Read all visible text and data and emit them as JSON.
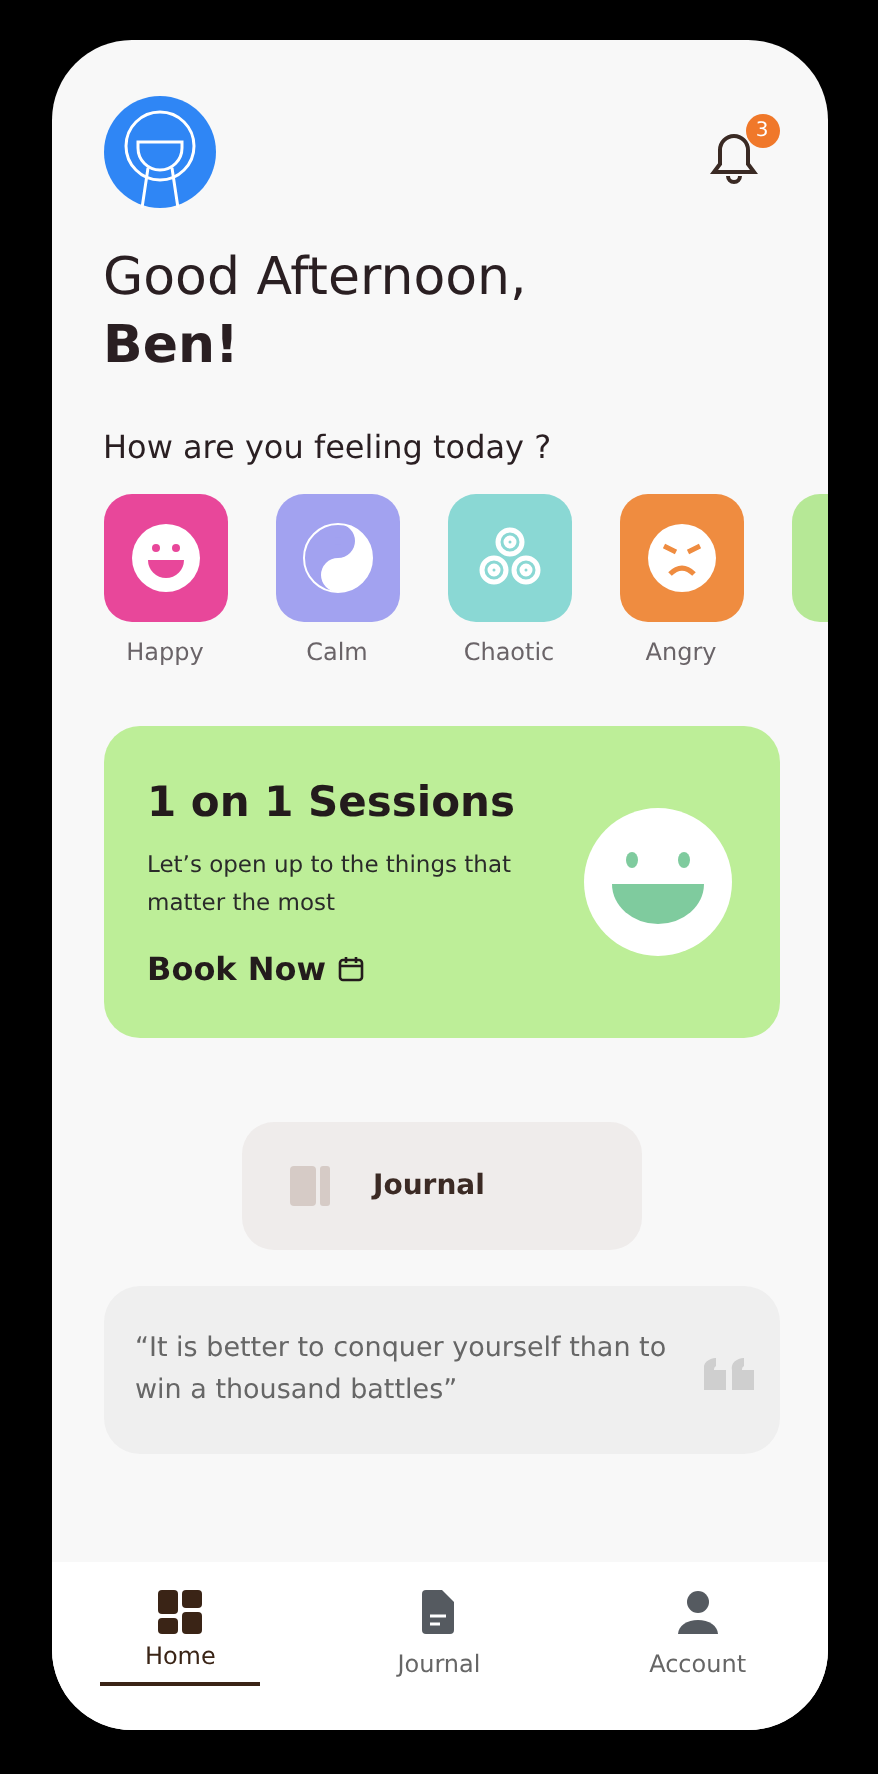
{
  "header": {
    "notification_count": "3"
  },
  "greeting": {
    "line_1": "Good Afternoon,",
    "line_2": "Ben!"
  },
  "mood_prompt": "How are you feeling today ?",
  "moods": [
    {
      "kind": "happy",
      "label": "Happy",
      "color": "#e8479a"
    },
    {
      "kind": "calm",
      "label": "Calm",
      "color": "#a2a2f0"
    },
    {
      "kind": "chaotic",
      "label": "Chaotic",
      "color": "#8ad8d4"
    },
    {
      "kind": "angry",
      "label": "Angry",
      "color": "#ef8c40"
    },
    {
      "kind": "partial",
      "color": "#b6e896"
    }
  ],
  "session_card": {
    "title": "1 on 1 Sessions",
    "text": "Let’s open up to the things that matter the most",
    "action": "Book Now"
  },
  "journal_button": "Journal",
  "quote": "“It is better to conquer yourself than to win a thousand battles”",
  "nav": [
    {
      "kind": "home",
      "label": "Home",
      "selected": true
    },
    {
      "kind": "journal",
      "label": "Journal",
      "selected": false
    },
    {
      "kind": "account",
      "label": "Account",
      "selected": false
    }
  ]
}
